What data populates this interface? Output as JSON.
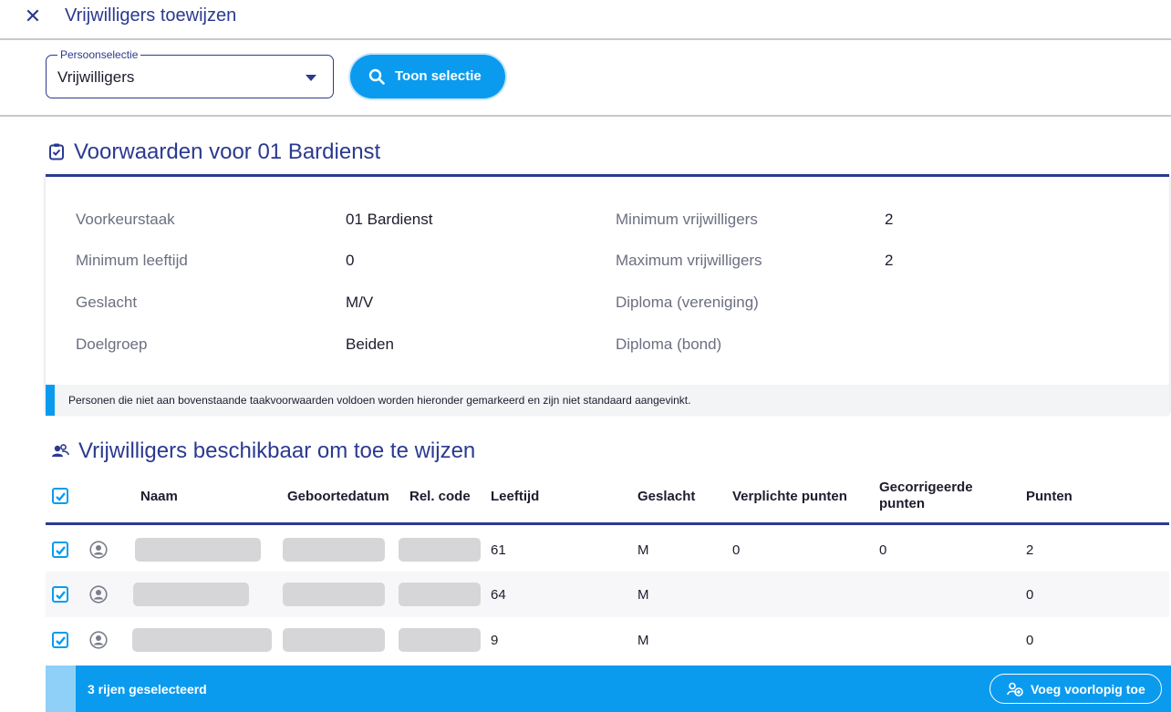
{
  "header": {
    "close_symbol": "✕",
    "title": "Vrijwilligers toewijzen"
  },
  "selection": {
    "legend": "Persoonselectie",
    "value": "Vrijwilligers",
    "button_label": "Toon selectie"
  },
  "conditions": {
    "title": "Voorwaarden voor 01 Bardienst",
    "icon": "clipboard-check-icon",
    "left": [
      {
        "label": "Voorkeurstaak",
        "value": "01 Bardienst"
      },
      {
        "label": "Minimum leeftijd",
        "value": "0"
      },
      {
        "label": "Geslacht",
        "value": "M/V"
      },
      {
        "label": "Doelgroep",
        "value": "Beiden"
      }
    ],
    "right": [
      {
        "label": "Minimum vrijwilligers",
        "value": "2"
      },
      {
        "label": "Maximum vrijwilligers",
        "value": "2"
      },
      {
        "label": "Diploma (vereniging)",
        "value": ""
      },
      {
        "label": "Diploma (bond)",
        "value": ""
      }
    ],
    "note": "Personen die niet aan bovenstaande taakvoorwaarden voldoen worden hieronder gemarkeerd en zijn niet standaard aangevinkt."
  },
  "volunteers": {
    "title": "Vrijwilligers beschikbaar om toe te wijzen",
    "icon": "users-icon",
    "columns": {
      "naam": "Naam",
      "geboortedatum": "Geboortedatum",
      "rel_code": "Rel. code",
      "leeftijd": "Leeftijd",
      "geslacht": "Geslacht",
      "verplichte_punten": "Verplichte punten",
      "gecorrigeerde_punten": "Gecorrigeerde punten",
      "punten": "Punten"
    },
    "rows": [
      {
        "checked": true,
        "leeftijd": "61",
        "geslacht": "M",
        "verplichte_punten": "0",
        "gecorrigeerde_punten": "0",
        "punten": "2"
      },
      {
        "checked": true,
        "leeftijd": "64",
        "geslacht": "M",
        "verplichte_punten": "",
        "gecorrigeerde_punten": "",
        "punten": "0"
      },
      {
        "checked": true,
        "leeftijd": "9",
        "geslacht": "M",
        "verplichte_punten": "",
        "gecorrigeerde_punten": "",
        "punten": "0"
      }
    ]
  },
  "footer": {
    "selected_text": "3 rijen geselecteerd",
    "button_label": "Voeg voorlopig toe"
  },
  "colors": {
    "primary": "#0a9bef",
    "navy": "#2b3a8f",
    "redacted": "#d6d6d8"
  }
}
